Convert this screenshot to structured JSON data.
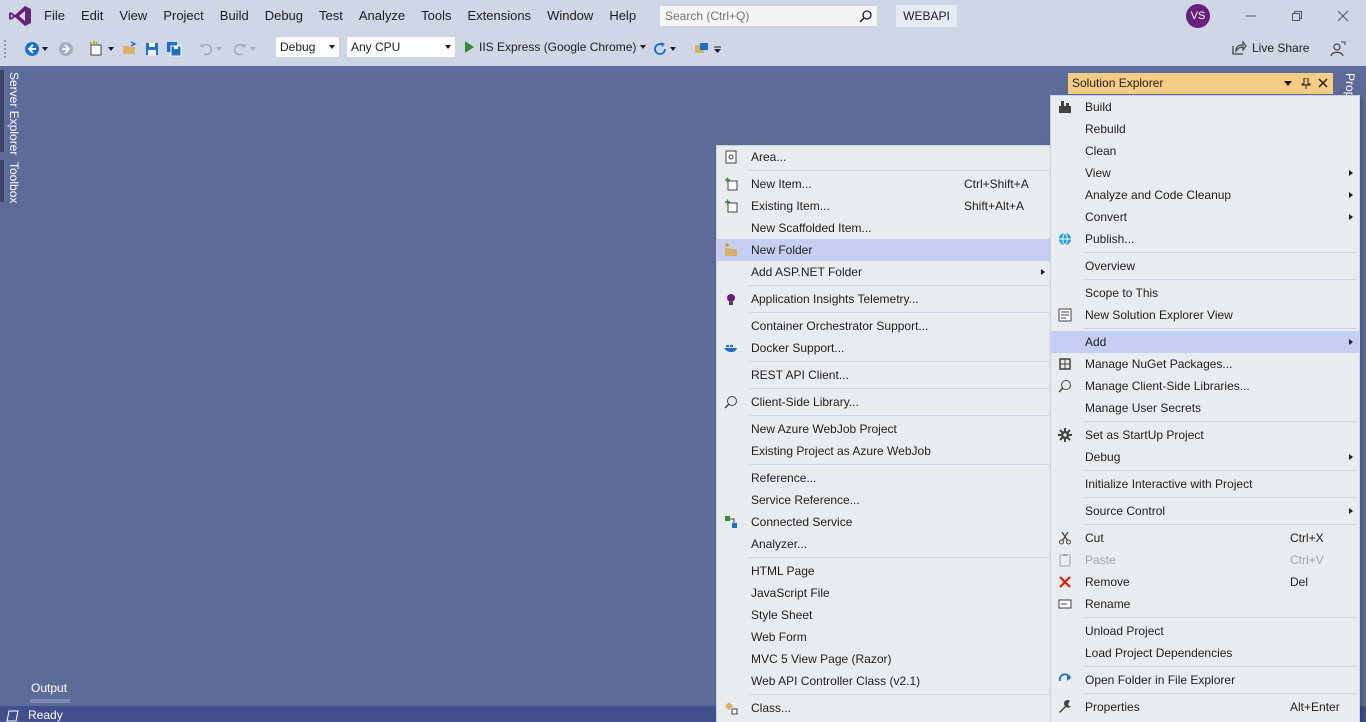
{
  "menubar": {
    "items": [
      "File",
      "Edit",
      "View",
      "Project",
      "Build",
      "Debug",
      "Test",
      "Analyze",
      "Tools",
      "Extensions",
      "Window",
      "Help"
    ]
  },
  "search": {
    "placeholder": "Search (Ctrl+Q)"
  },
  "project_name": "WEBAPI",
  "user_initials": "VS",
  "toolbar": {
    "configuration": "Debug",
    "platform": "Any CPU",
    "run_target": "IIS Express (Google Chrome)",
    "live_share": "Live Share"
  },
  "side_tabs": {
    "server_explorer": "Server Explorer",
    "toolbox": "Toolbox"
  },
  "solution_explorer": {
    "title": "Solution Explorer",
    "properties_tab": "Properties"
  },
  "output_tab": "Output",
  "status": "Ready",
  "add_menu": {
    "items": [
      {
        "label": "Area...",
        "icon": "area-icon"
      },
      {
        "sep": true
      },
      {
        "label": "New Item...",
        "shortcut": "Ctrl+Shift+A",
        "icon": "new-item-icon"
      },
      {
        "label": "Existing Item...",
        "shortcut": "Shift+Alt+A",
        "icon": "existing-item-icon"
      },
      {
        "label": "New Scaffolded Item..."
      },
      {
        "label": "New Folder",
        "icon": "new-folder-icon",
        "highlighted": true
      },
      {
        "label": "Add ASP.NET Folder",
        "submenu": true
      },
      {
        "sep": true
      },
      {
        "label": "Application Insights Telemetry...",
        "icon": "app-insights-icon"
      },
      {
        "sep": true
      },
      {
        "label": "Container Orchestrator Support..."
      },
      {
        "label": "Docker Support...",
        "icon": "docker-icon"
      },
      {
        "sep": true
      },
      {
        "label": "REST API Client..."
      },
      {
        "sep": true
      },
      {
        "label": "Client-Side Library...",
        "icon": "client-library-icon"
      },
      {
        "sep": true
      },
      {
        "label": "New Azure WebJob Project"
      },
      {
        "label": "Existing Project as Azure WebJob"
      },
      {
        "sep": true
      },
      {
        "label": "Reference..."
      },
      {
        "label": "Service Reference..."
      },
      {
        "label": "Connected Service",
        "icon": "connected-service-icon"
      },
      {
        "label": "Analyzer..."
      },
      {
        "sep": true
      },
      {
        "label": "HTML Page"
      },
      {
        "label": "JavaScript File"
      },
      {
        "label": "Style Sheet"
      },
      {
        "label": "Web Form"
      },
      {
        "label": "MVC 5 View Page (Razor)"
      },
      {
        "label": "Web API Controller Class (v2.1)"
      },
      {
        "sep": true
      },
      {
        "label": "Class...",
        "icon": "class-icon"
      }
    ]
  },
  "project_menu": {
    "items": [
      {
        "label": "Build",
        "icon": "build-icon"
      },
      {
        "label": "Rebuild"
      },
      {
        "label": "Clean"
      },
      {
        "label": "View",
        "submenu": true
      },
      {
        "label": "Analyze and Code Cleanup",
        "submenu": true
      },
      {
        "label": "Convert",
        "submenu": true
      },
      {
        "label": "Publish...",
        "icon": "publish-globe-icon"
      },
      {
        "sep": true
      },
      {
        "label": "Overview"
      },
      {
        "sep": true
      },
      {
        "label": "Scope to This"
      },
      {
        "label": "New Solution Explorer View",
        "icon": "new-view-icon"
      },
      {
        "sep": true
      },
      {
        "label": "Add",
        "submenu": true,
        "highlighted": true
      },
      {
        "label": "Manage NuGet Packages...",
        "icon": "nuget-icon"
      },
      {
        "label": "Manage Client-Side Libraries...",
        "icon": "client-library-icon"
      },
      {
        "label": "Manage User Secrets"
      },
      {
        "sep": true
      },
      {
        "label": "Set as StartUp Project",
        "icon": "gear-icon"
      },
      {
        "label": "Debug",
        "submenu": true
      },
      {
        "sep": true
      },
      {
        "label": "Initialize Interactive with Project"
      },
      {
        "sep": true
      },
      {
        "label": "Source Control",
        "submenu": true
      },
      {
        "sep": true
      },
      {
        "label": "Cut",
        "shortcut": "Ctrl+X",
        "icon": "scissors-icon"
      },
      {
        "label": "Paste",
        "shortcut": "Ctrl+V",
        "icon": "paste-icon",
        "disabled": true
      },
      {
        "label": "Remove",
        "shortcut": "Del",
        "icon": "remove-x-icon"
      },
      {
        "label": "Rename",
        "icon": "rename-icon"
      },
      {
        "sep": true
      },
      {
        "label": "Unload Project"
      },
      {
        "label": "Load Project Dependencies"
      },
      {
        "sep": true
      },
      {
        "label": "Open Folder in File Explorer",
        "icon": "open-folder-arrow-icon"
      },
      {
        "sep": true
      },
      {
        "label": "Properties",
        "shortcut": "Alt+Enter",
        "icon": "wrench-icon"
      }
    ]
  },
  "colors": {
    "titlebar": "#cfd6e5",
    "editor_bg": "#5d6b99",
    "tool_header": "#f5cc84",
    "menu_bg": "#e9ecee",
    "highlight": "#c5cff1",
    "statusbar": "#40508d",
    "accent": "#68217a"
  }
}
